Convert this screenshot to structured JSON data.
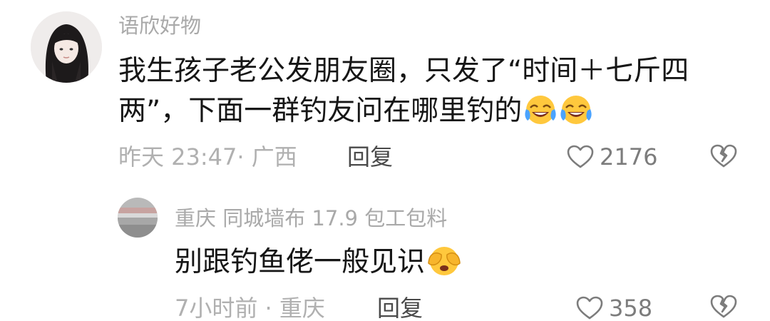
{
  "comment": {
    "username": "语欣好物",
    "text": "我生孩子老公发朋友圈，只发了“时间＋七斤四两”，下面一群钓友问在哪里钓的",
    "emojis": [
      "rofl-emoji",
      "rofl-emoji"
    ],
    "time": "昨天 23:47",
    "location": "广西",
    "meta": "昨天 23:47· 广西",
    "reply_label": "回复",
    "like_count": "2176"
  },
  "reply": {
    "username": "重庆 同城墙布 17.9 包工包料",
    "text": "别跟钓鱼佬一般见识",
    "emoji": "covering-eyes-emoji",
    "time": "7小时前",
    "location": "重庆",
    "meta": "7小时前 · 重庆",
    "reply_label": "回复",
    "like_count": "358"
  },
  "colors": {
    "background": "#ffffff",
    "text_primary": "#161616",
    "text_secondary": "#a9a9a9",
    "reply_action": "#4a4a4a",
    "emoji_yellow": "#ffc83d",
    "tear_blue": "#4aa3ff"
  }
}
